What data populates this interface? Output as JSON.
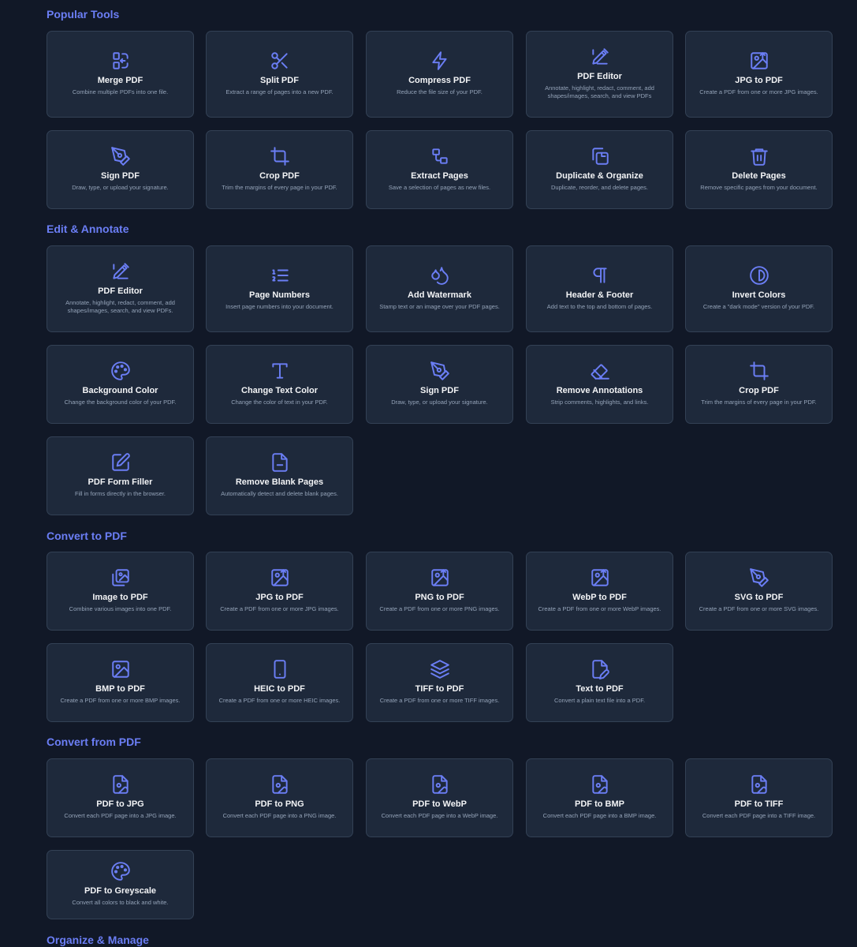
{
  "sections": [
    {
      "title": "Popular Tools",
      "tools": [
        {
          "name": "Merge PDF",
          "desc": "Combine multiple PDFs into one file.",
          "icon": "merge-icon"
        },
        {
          "name": "Split PDF",
          "desc": "Extract a range of pages into a new PDF.",
          "icon": "scissors-icon"
        },
        {
          "name": "Compress PDF",
          "desc": "Reduce the file size of your PDF.",
          "icon": "lightning-icon"
        },
        {
          "name": "PDF Editor",
          "desc": "Annotate, highlight, redact, comment, add shapes/images, search, and view PDFs",
          "icon": "edit-pen-icon"
        },
        {
          "name": "JPG to PDF",
          "desc": "Create a PDF from one or more JPG images.",
          "icon": "image-upload-icon"
        },
        {
          "name": "Sign PDF",
          "desc": "Draw, type, or upload your signature.",
          "icon": "pen-nib-icon"
        },
        {
          "name": "Crop PDF",
          "desc": "Trim the margins of every page in your PDF.",
          "icon": "crop-icon"
        },
        {
          "name": "Extract Pages",
          "desc": "Save a selection of pages as new files.",
          "icon": "extract-icon"
        },
        {
          "name": "Duplicate & Organize",
          "desc": "Duplicate, reorder, and delete pages.",
          "icon": "copy-icon"
        },
        {
          "name": "Delete Pages",
          "desc": "Remove specific pages from your document.",
          "icon": "trash-icon"
        }
      ]
    },
    {
      "title": "Edit & Annotate",
      "tools": [
        {
          "name": "PDF Editor",
          "desc": "Annotate, highlight, redact, comment, add shapes/images, search, and view PDFs.",
          "icon": "edit-pen-icon"
        },
        {
          "name": "Page Numbers",
          "desc": "Insert page numbers into your document.",
          "icon": "numbered-list-icon"
        },
        {
          "name": "Add Watermark",
          "desc": "Stamp text or an image over your PDF pages.",
          "icon": "droplets-icon"
        },
        {
          "name": "Header & Footer",
          "desc": "Add text to the top and bottom of pages.",
          "icon": "pilcrow-icon"
        },
        {
          "name": "Invert Colors",
          "desc": "Create a \"dark mode\" version of your PDF.",
          "icon": "contrast-icon"
        },
        {
          "name": "Background Color",
          "desc": "Change the background color of your PDF.",
          "icon": "palette-icon"
        },
        {
          "name": "Change Text Color",
          "desc": "Change the color of text in your PDF.",
          "icon": "type-icon"
        },
        {
          "name": "Sign PDF",
          "desc": "Draw, type, or upload your signature.",
          "icon": "pen-nib-icon"
        },
        {
          "name": "Remove Annotations",
          "desc": "Strip comments, highlights, and links.",
          "icon": "eraser-icon"
        },
        {
          "name": "Crop PDF",
          "desc": "Trim the margins of every page in your PDF.",
          "icon": "crop-icon"
        },
        {
          "name": "PDF Form Filler",
          "desc": "Fill in forms directly in the browser.",
          "icon": "square-pen-icon"
        },
        {
          "name": "Remove Blank Pages",
          "desc": "Automatically detect and delete blank pages.",
          "icon": "file-minus-icon"
        }
      ]
    },
    {
      "title": "Convert to PDF",
      "tools": [
        {
          "name": "Image to PDF",
          "desc": "Combine various images into one PDF.",
          "icon": "images-icon"
        },
        {
          "name": "JPG to PDF",
          "desc": "Create a PDF from one or more JPG images.",
          "icon": "image-upload-icon"
        },
        {
          "name": "PNG to PDF",
          "desc": "Create a PDF from one or more PNG images.",
          "icon": "image-upload-icon"
        },
        {
          "name": "WebP to PDF",
          "desc": "Create a PDF from one or more WebP images.",
          "icon": "image-upload-icon"
        },
        {
          "name": "SVG to PDF",
          "desc": "Create a PDF from one or more SVG images.",
          "icon": "pen-nib-icon"
        },
        {
          "name": "BMP to PDF",
          "desc": "Create a PDF from one or more BMP images.",
          "icon": "image-icon"
        },
        {
          "name": "HEIC to PDF",
          "desc": "Create a PDF from one or more HEIC images.",
          "icon": "phone-icon"
        },
        {
          "name": "TIFF to PDF",
          "desc": "Create a PDF from one or more TIFF images.",
          "icon": "layers-icon"
        },
        {
          "name": "Text to PDF",
          "desc": "Convert a plain text file into a PDF.",
          "icon": "file-pen-icon"
        }
      ]
    },
    {
      "title": "Convert from PDF",
      "tools": [
        {
          "name": "PDF to JPG",
          "desc": "Convert each PDF page into a JPG image.",
          "icon": "file-image-icon"
        },
        {
          "name": "PDF to PNG",
          "desc": "Convert each PDF page into a PNG image.",
          "icon": "file-image-icon"
        },
        {
          "name": "PDF to WebP",
          "desc": "Convert each PDF page into a WebP image.",
          "icon": "file-image-icon"
        },
        {
          "name": "PDF to BMP",
          "desc": "Convert each PDF page into a BMP image.",
          "icon": "file-image-icon"
        },
        {
          "name": "PDF to TIFF",
          "desc": "Convert each PDF page into a TIFF image.",
          "icon": "file-image-icon"
        },
        {
          "name": "PDF to Greyscale",
          "desc": "Convert all colors to black and white.",
          "icon": "palette-icon"
        }
      ]
    },
    {
      "title": "Organize & Manage",
      "tools": []
    }
  ]
}
